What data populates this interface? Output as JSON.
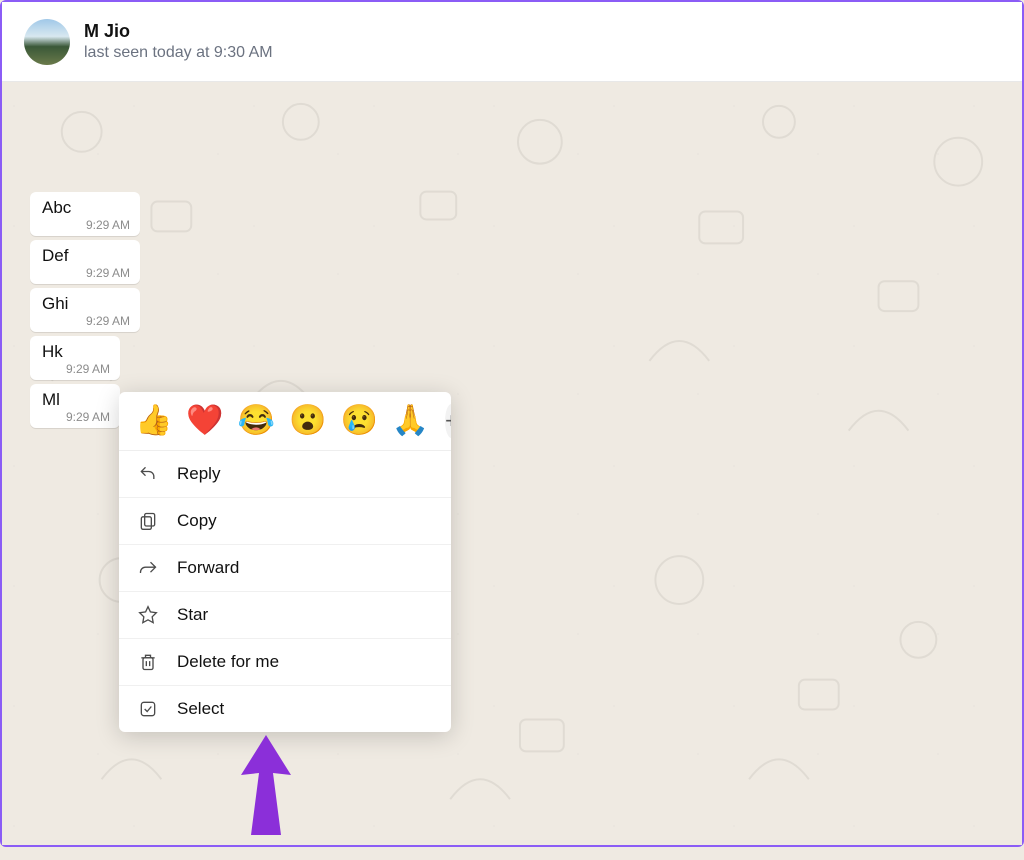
{
  "header": {
    "name": "M Jio",
    "status": "last seen today at 9:30 AM"
  },
  "messages": [
    {
      "text": "Abc",
      "time": "9:29 AM"
    },
    {
      "text": "Def",
      "time": "9:29 AM"
    },
    {
      "text": "Ghi",
      "time": "9:29 AM"
    },
    {
      "text": "Hk",
      "time": "9:29 AM"
    },
    {
      "text": "Ml",
      "time": "9:29 AM"
    }
  ],
  "reactions": [
    "👍",
    "❤️",
    "😂",
    "😮",
    "😢",
    "🙏"
  ],
  "menu": {
    "reply": "Reply",
    "copy": "Copy",
    "forward": "Forward",
    "star": "Star",
    "delete": "Delete for me",
    "select": "Select"
  }
}
